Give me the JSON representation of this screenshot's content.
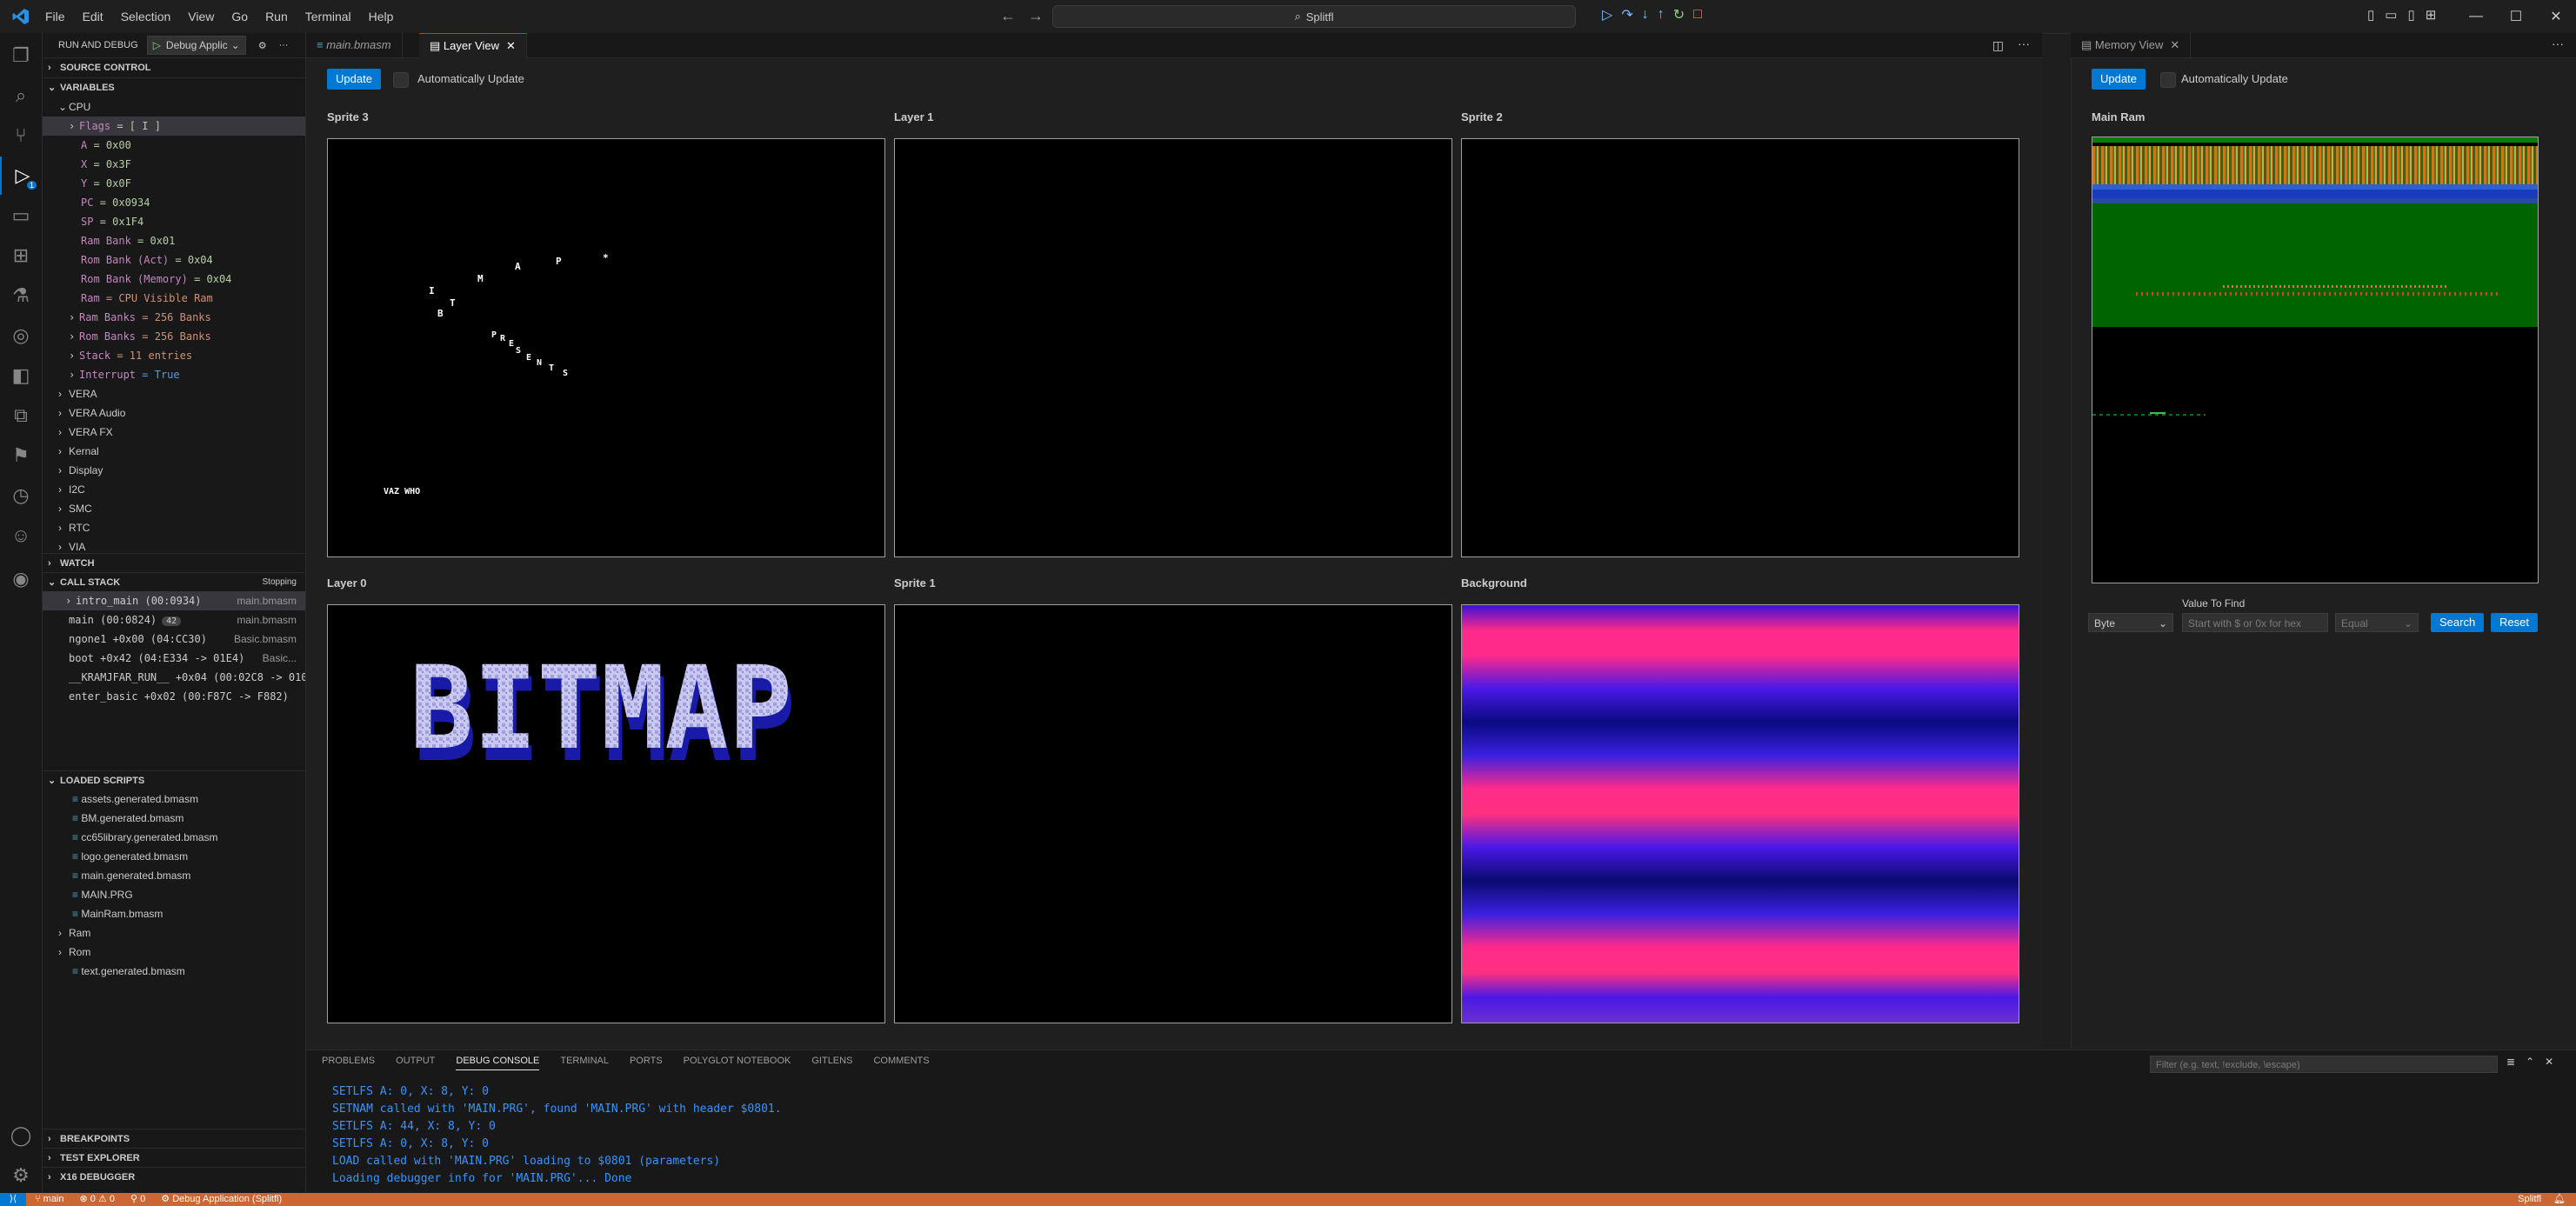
{
  "menu": [
    "File",
    "Edit",
    "Selection",
    "View",
    "Go",
    "Run",
    "Terminal",
    "Help"
  ],
  "search": {
    "label": "Splitfl"
  },
  "sidebar": {
    "title": "RUN AND DEBUG",
    "config": "Debug Applic",
    "sections": {
      "source_control": "SOURCE CONTROL",
      "variables": "VARIABLES",
      "watch": "WATCH",
      "call_stack": "CALL STACK",
      "call_stack_state": "Stopping",
      "loaded_scripts": "LOADED SCRIPTS",
      "breakpoints": "BREAKPOINTS",
      "test_explorer": "TEST EXPLORER",
      "x16_debugger": "X16 DEBUGGER"
    },
    "cpu_label": "CPU",
    "cpu_vars": [
      {
        "name": "Flags",
        "value": "= [     I  ]",
        "expandable": true
      },
      {
        "name": "A",
        "value": "= 0x00"
      },
      {
        "name": "X",
        "value": "= 0x3F"
      },
      {
        "name": "Y",
        "value": "= 0x0F"
      },
      {
        "name": "PC",
        "value": "= 0x0934"
      },
      {
        "name": "SP",
        "value": "= 0x1F4"
      },
      {
        "name": "Ram Bank",
        "value": "= 0x01"
      },
      {
        "name": "Rom Bank (Act)",
        "value": "= 0x04"
      },
      {
        "name": "Rom Bank (Memory)",
        "value": "= 0x04"
      },
      {
        "name": "Ram",
        "value": "= CPU Visible Ram"
      },
      {
        "name": "Ram Banks",
        "value": "= 256 Banks",
        "expandable": true
      },
      {
        "name": "Rom Banks",
        "value": "= 256 Banks",
        "expandable": true
      },
      {
        "name": "Stack",
        "value": "= 11 entries",
        "expandable": true
      },
      {
        "name": "Interrupt",
        "value": "= True",
        "expandable": true
      }
    ],
    "var_groups": [
      "VERA",
      "VERA Audio",
      "VERA FX",
      "Kernal",
      "Display",
      "I2C",
      "SMC",
      "RTC",
      "VIA"
    ],
    "call_stack": [
      {
        "frame": "intro_main (00:0934)",
        "file": "main.bmasm",
        "line": ""
      },
      {
        "frame": "main (00:0824)",
        "file": "main.bmasm",
        "line": "42"
      },
      {
        "frame": "ngone1 +0x00 (04:CC30)",
        "file": "Basic.bmasm",
        "line": ""
      },
      {
        "frame": "boot +0x42 (04:E334 -> 01E4)",
        "file": "Basic...",
        "line": ""
      },
      {
        "frame": "__KRAMJFAR_RUN__ +0x04 (00:02C8 -> 010",
        "file": "",
        "line": ""
      },
      {
        "frame": "enter_basic +0x02 (00:F87C -> F882)",
        "file": "",
        "line": ""
      }
    ],
    "loaded_scripts": [
      "assets.generated.bmasm",
      "BM.generated.bmasm",
      "cc65library.generated.bmasm",
      "logo.generated.bmasm",
      "main.generated.bmasm",
      "MAIN.PRG",
      "MainRam.bmasm"
    ],
    "script_folders": [
      "Ram",
      "Rom"
    ],
    "script_extra": "text.generated.bmasm"
  },
  "editor": {
    "tab_inactive": "main.bmasm",
    "tab_active": "Layer View",
    "update_label": "Update",
    "auto_update_label": "Automatically Update",
    "panels": [
      "Sprite 3",
      "Layer 1",
      "Sprite 2",
      "Layer 0",
      "Sprite 1",
      "Background"
    ],
    "sprite_text": {
      "word1": [
        "B",
        "I",
        "T",
        "M",
        "A",
        "P",
        "*"
      ],
      "word2": [
        "P",
        "R",
        "E",
        "S",
        "E",
        "N",
        "T",
        "S"
      ],
      "credit": "VAZ WHO"
    },
    "logo_text": "BITMAP"
  },
  "memory": {
    "tab": "Memory View",
    "update_label": "Update",
    "auto_update_label": "Automatically Update",
    "title": "Main Ram",
    "value_to_find_label": "Value To Find",
    "type_select": "Byte",
    "value_placeholder": "Start with $ or 0x for hex",
    "compare_select": "Equal",
    "search_label": "Search",
    "reset_label": "Reset"
  },
  "panel": {
    "tabs": [
      "PROBLEMS",
      "OUTPUT",
      "DEBUG CONSOLE",
      "TERMINAL",
      "PORTS",
      "POLYGLOT NOTEBOOK",
      "GITLENS",
      "COMMENTS"
    ],
    "active_tab": "DEBUG CONSOLE",
    "filter_placeholder": "Filter (e.g. text, !exclude, \\escape)",
    "console_lines": [
      "SETLFS A: 0, X: 8, Y: 0",
      "SETNAM called with 'MAIN.PRG', found 'MAIN.PRG' with header $0801.",
      "SETLFS A: 44, X: 8, Y: 0",
      "SETLFS A: 0, X: 8, Y: 0",
      "LOAD called with 'MAIN.PRG' loading to $0801 (parameters)",
      "Loading debugger info for 'MAIN.PRG'... Done"
    ]
  },
  "status": {
    "branch": "main",
    "errors": "0",
    "warnings": "0",
    "ports": "0",
    "debug": "Debug Application (Splitfl)",
    "right": "Splitfl"
  },
  "colors": {
    "accent": "#0078d4",
    "status_bar": "#cc6633",
    "variable_name": "#c586c0",
    "variable_value": "#b5cea8",
    "console_text": "#3794ff",
    "memory_green": "#006400",
    "bg_pink": "#ff2a8a",
    "bg_blue": "#1010d0",
    "logo_face": "#c8c8f0",
    "logo_shadow": "#1a1aa8"
  }
}
